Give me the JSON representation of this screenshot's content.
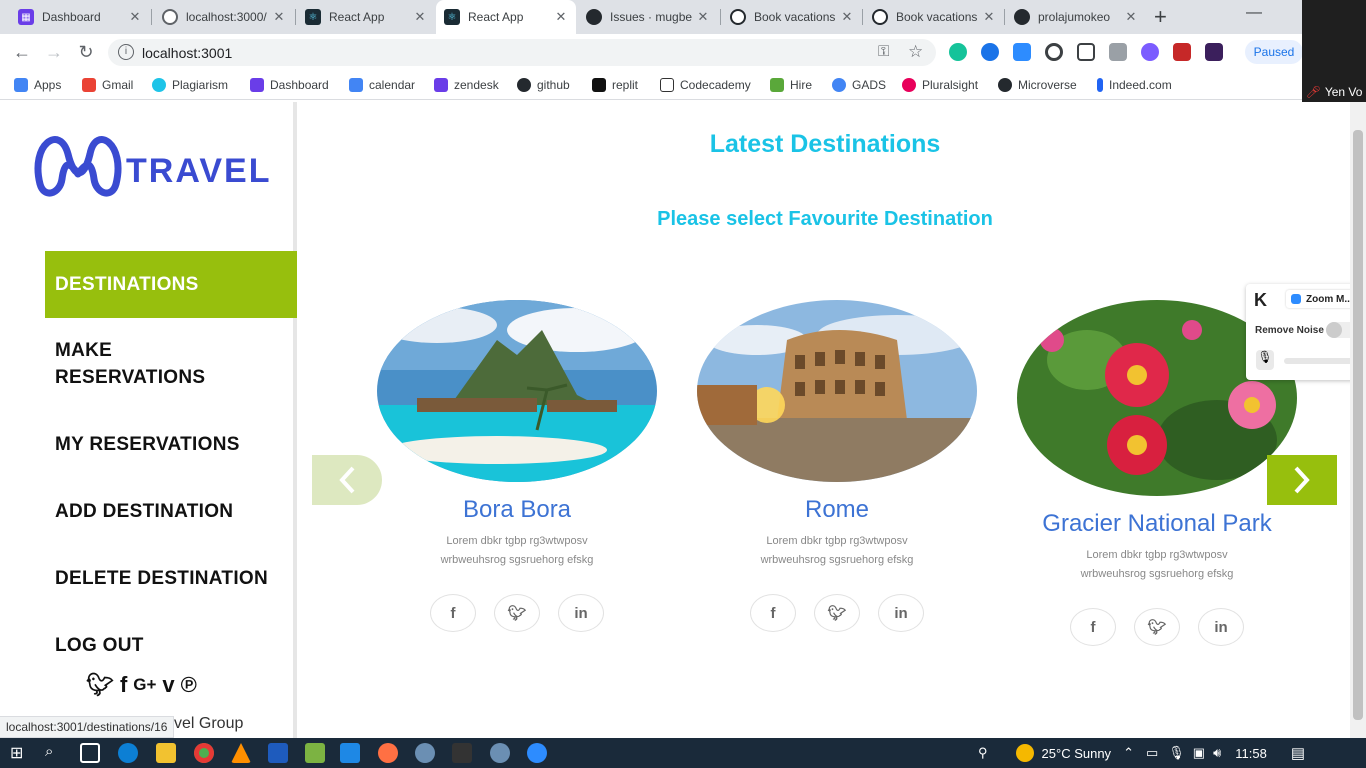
{
  "browser": {
    "tabs": [
      {
        "title": "Dashboard",
        "icon": "grid-icon",
        "color": "#6a3de8"
      },
      {
        "title": "localhost:3000/",
        "icon": "globe-icon",
        "color": "#5f6368"
      },
      {
        "title": "React App",
        "icon": "react-icon",
        "color": "#1a2b34"
      },
      {
        "title": "React App",
        "icon": "react-icon",
        "color": "#1a2b34"
      },
      {
        "title": "Issues · mugbe",
        "icon": "github-icon",
        "color": "#24292e"
      },
      {
        "title": "Book vacations",
        "icon": "refresh-icon",
        "color": "#24292e"
      },
      {
        "title": "Book vacations",
        "icon": "refresh-icon",
        "color": "#24292e"
      },
      {
        "title": "prolajumokeo",
        "icon": "github-icon",
        "color": "#24292e"
      }
    ],
    "new_tab": "+",
    "url": "localhost:3001",
    "paused_label": "Paused",
    "bookmarks": [
      {
        "label": "Apps",
        "color": "#4285f4"
      },
      {
        "label": "Gmail",
        "color": "#ea4335"
      },
      {
        "label": "Plagiarism",
        "color": "#1ec4e8"
      },
      {
        "label": "Dashboard",
        "color": "#6a3de8"
      },
      {
        "label": "calendar",
        "color": "#4285f4"
      },
      {
        "label": "zendesk",
        "color": "#6a3de8"
      },
      {
        "label": "github",
        "color": "#24292e"
      },
      {
        "label": "replit",
        "color": "#111"
      },
      {
        "label": "Codecademy",
        "color": "#333"
      },
      {
        "label": "Hire",
        "color": "#5aa83a"
      },
      {
        "label": "GADS",
        "color": "#4285f4"
      },
      {
        "label": "Pluralsight",
        "color": "#e8005a"
      },
      {
        "label": "Microverse",
        "color": "#24292e"
      },
      {
        "label": "Indeed.com",
        "color": "#2164f3"
      }
    ],
    "zoom_user": "Yen Vo",
    "status_url": "localhost:3001/destinations/16"
  },
  "app": {
    "logo_text": "TRAVEL",
    "logo_color": "#3a4bd1",
    "nav": [
      {
        "label": "DESTINATIONS",
        "active": true
      },
      {
        "label": "MAKE RESERVATIONS",
        "active": false
      },
      {
        "label": "MY RESERVATIONS",
        "active": false
      },
      {
        "label": "ADD DESTINATION",
        "active": false
      },
      {
        "label": "DELETE DESTINATION",
        "active": false
      },
      {
        "label": "LOG OUT",
        "active": false
      }
    ],
    "social_icons": [
      "twitter-icon",
      "facebook-icon",
      "google-plus-icon",
      "vimeo-icon",
      "pinterest-icon"
    ],
    "copyright": "vel Group",
    "accent": "#97bf0d",
    "title_color": "#1ac3e6"
  },
  "main": {
    "title": "Latest Destinations",
    "subtitle": "Please select Favourite Destination",
    "cards": [
      {
        "name": "Bora Bora",
        "description": "Lorem dbkr tgbp rg3wtwposv wrbweuhsrog sgsruehorg efskg"
      },
      {
        "name": "Rome",
        "description": "Lorem dbkr tgbp rg3wtwposv wrbweuhsrog sgsruehorg efskg"
      },
      {
        "name": "Gracier National Park",
        "description": "Lorem dbkr tgbp rg3wtwposv wrbweuhsrog sgsruehorg efskg"
      }
    ]
  },
  "zoom_panel": {
    "app": "Zoom M...",
    "remove_noise": "Remove Noise"
  },
  "taskbar": {
    "weather": "25°C  Sunny",
    "time": "11:58"
  }
}
